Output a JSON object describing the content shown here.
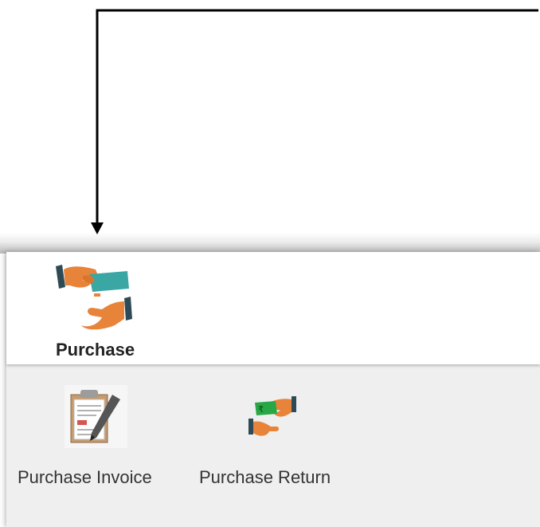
{
  "module": {
    "label": "Purchase",
    "icon": "hand-exchange-money-icon"
  },
  "actions": [
    {
      "label": "Purchase Invoice",
      "icon": "invoice-pen-icon"
    },
    {
      "label": "Purchase Return",
      "icon": "money-return-hands-icon"
    }
  ],
  "colors": {
    "connector": "#000000",
    "panel_background": "#efefef",
    "header_background": "#ffffff",
    "hand_orange": "#e8833a",
    "cuff_dark": "#2e4a57",
    "money_teal": "#3aa7a5",
    "money_green": "#28a745"
  }
}
